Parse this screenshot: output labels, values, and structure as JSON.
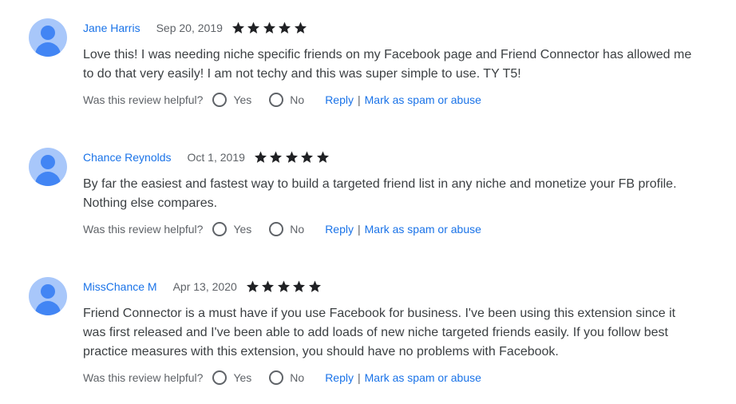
{
  "helpful_prompt": "Was this review helpful?",
  "yes_label": "Yes",
  "no_label": "No",
  "reply_label": "Reply",
  "separator": "|",
  "spam_label": "Mark as spam or abuse",
  "star_color": "#202124",
  "avatar_icon": "person-avatar-icon",
  "reviews": [
    {
      "author": "Jane Harris",
      "date": "Sep 20, 2019",
      "rating": 5,
      "lines": [
        "Love this!  I was needing niche specific friends on my Facebook page and Friend Connector has allowed me",
        "to do that very easily!  I am not techy and this was super simple to use.  TY T5!"
      ]
    },
    {
      "author": "Chance Reynolds",
      "date": "Oct 1, 2019",
      "rating": 5,
      "lines": [
        "By far the easiest and fastest way to build a targeted friend list in any niche and monetize your FB profile.",
        "Nothing else compares."
      ]
    },
    {
      "author": "MissChance M",
      "date": "Apr 13, 2020",
      "rating": 5,
      "lines": [
        "Friend Connector is a must have if you use Facebook for business. I've been using this extension since it",
        "was first released and I've been able to add loads of new niche targeted friends easily. If you follow best",
        "practice measures with this extension, you should have no problems with Facebook."
      ]
    }
  ]
}
